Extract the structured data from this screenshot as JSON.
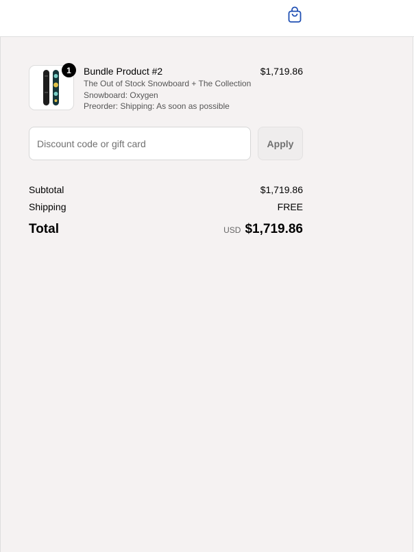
{
  "header": {
    "cart_icon": "shopping-bag-icon",
    "accent_color": "#1f4fb3"
  },
  "line_item": {
    "quantity": "1",
    "title": "Bundle Product #2",
    "components": [
      "The Out of Stock Snowboard + The Collection",
      "Snowboard: Oxygen"
    ],
    "preorder_note": "Preorder: Shipping: As soon as possible",
    "price": "$1,719.86",
    "image_icon": "snowboard-image"
  },
  "discount": {
    "placeholder": "Discount code or gift card",
    "value": "",
    "apply_label": "Apply"
  },
  "totals": {
    "subtotal_label": "Subtotal",
    "subtotal_value": "$1,719.86",
    "shipping_label": "Shipping",
    "shipping_value": "FREE",
    "total_label": "Total",
    "currency": "USD",
    "total_value": "$1,719.86"
  }
}
